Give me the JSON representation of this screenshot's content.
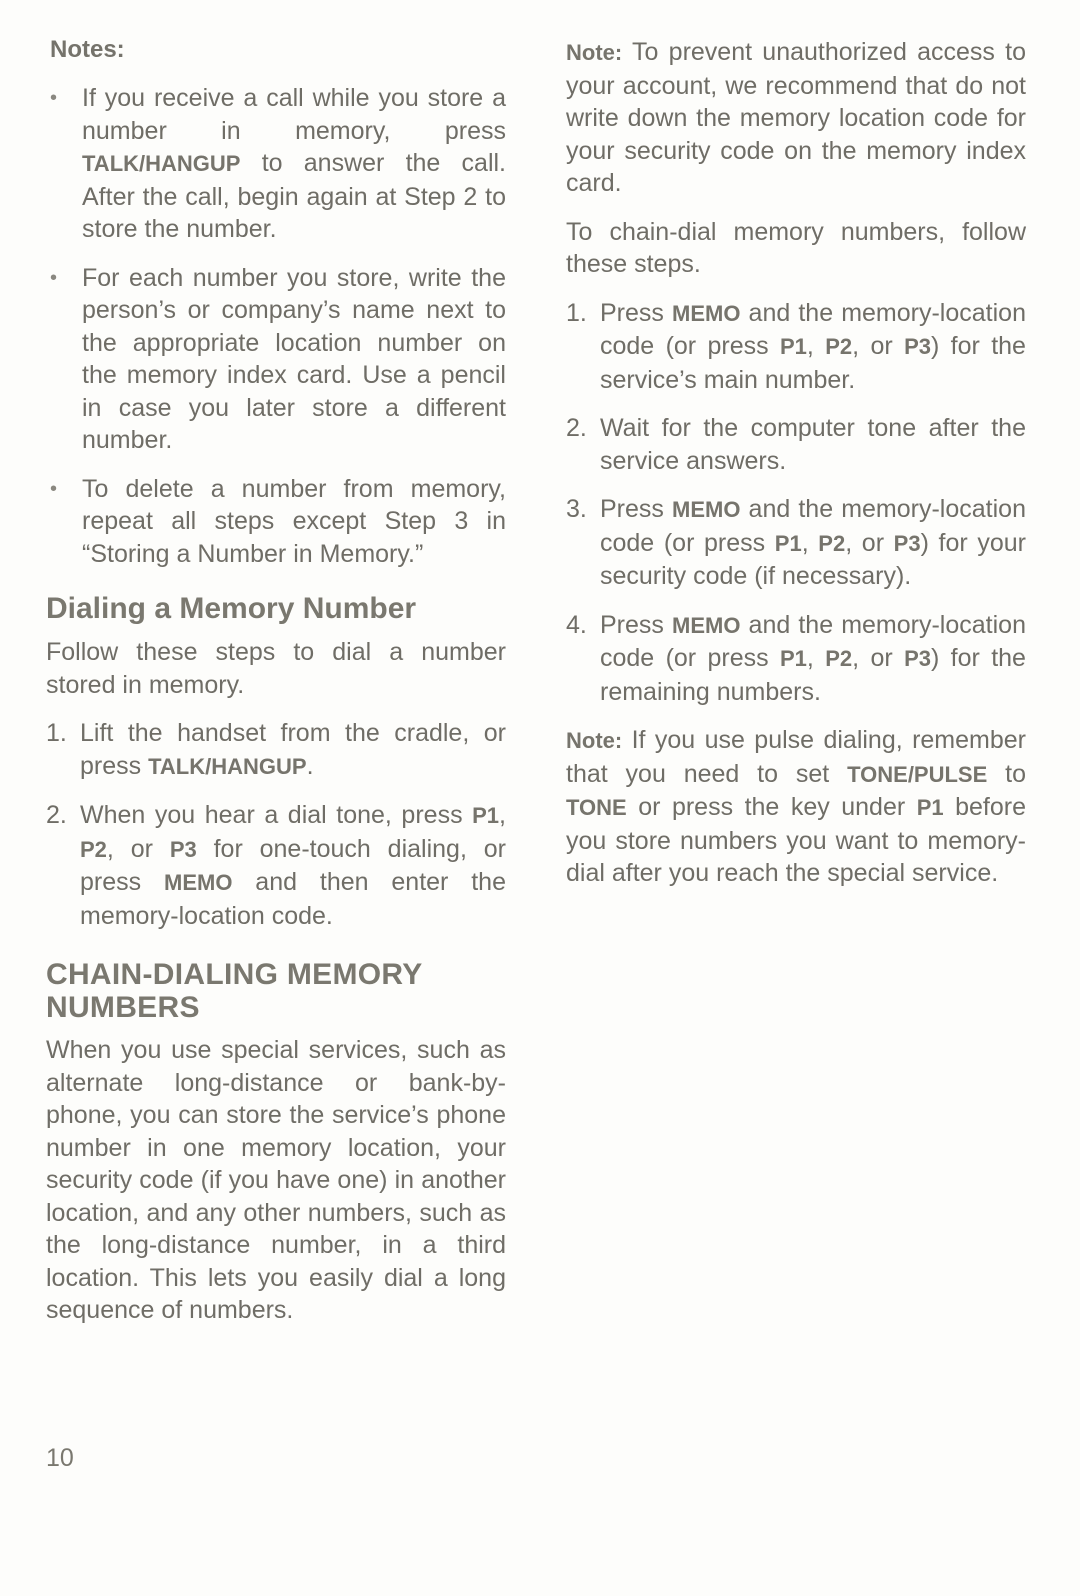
{
  "page_number": "10",
  "left": {
    "notes_title": "Notes:",
    "notes": [
      {
        "pre": "If you receive a call while you store a number in memory, press ",
        "key": "TALK/HANGUP",
        "post": " to answer the call. After the call, begin again at Step 2 to store the number."
      },
      {
        "pre": "For each number you store, write the person’s or company’s name next to the appropriate location number on the memory index card. Use a pencil in case you later store a different number.",
        "key": "",
        "post": ""
      },
      {
        "pre": "To delete a number from memory, repeat all steps except Step 3 in “Storing a Number in Memory.”",
        "key": "",
        "post": ""
      }
    ],
    "dialing_heading": "Dialing a Memory Number",
    "dialing_intro": "Follow these steps to dial a number stored in memory.",
    "dialing_steps": [
      {
        "num": "1.",
        "t1": "Lift the handset from the cradle, or press ",
        "k1": "TALK/HANGUP",
        "t2": "."
      },
      {
        "num": "2.",
        "t1": "When you hear a dial tone, press ",
        "k1": "P1",
        "t2": ", ",
        "k2": "P2",
        "t3": ", or ",
        "k3": "P3",
        "t4": " for one-touch dialing, or press ",
        "k4": "MEMO",
        "t5": " and then enter the memory-location code."
      }
    ],
    "chain_heading_line1": "CHAIN-DIALING MEMORY",
    "chain_heading_line2": "NUMBERS",
    "chain_body": "When you use special services, such as alternate long-distance or bank-by-phone, you can store the service’s phone number in one memory location, your security code (if you have one) in another location, and any other numbers, such as the long-distance number, in a third location. This lets you easily dial a long sequence of numbers."
  },
  "right": {
    "note1_label": "Note:",
    "note1_text": " To prevent unauthorized access to your account, we recommend that do not write down the memory location code for your security code on the memory index card.",
    "chain_intro": "To chain-dial memory numbers, follow these steps.",
    "steps": [
      {
        "num": "1.",
        "t1": "Press ",
        "k1": "MEMO",
        "t2": " and the memory-location code (or press ",
        "k2": "P1",
        "t3": ", ",
        "k3": "P2",
        "t4": ", or ",
        "k4": "P3",
        "t5": ") for the service’s main number."
      },
      {
        "num": "2.",
        "t1": "Wait for the computer tone after the service answers."
      },
      {
        "num": "3.",
        "t1": "Press ",
        "k1": "MEMO",
        "t2": " and the memory-location code (or press ",
        "k2": "P1",
        "t3": ", ",
        "k3": "P2",
        "t4": ", or ",
        "k4": "P3",
        "t5": ") for your security code (if necessary)."
      },
      {
        "num": "4.",
        "t1": "Press ",
        "k1": "MEMO",
        "t2": " and the memory-location code (or press ",
        "k2": "P1",
        "t3": ", ",
        "k3": "P2",
        "t4": ", or ",
        "k4": "P3",
        "t5": ") for the remaining numbers."
      }
    ],
    "note2_label": "Note:",
    "note2_t1": " If you use pulse dialing, remember that you need to set ",
    "note2_k1": "TONE/PULSE",
    "note2_t2": " to ",
    "note2_k2": "TONE",
    "note2_t3": " or press the key under ",
    "note2_k3": "P1",
    "note2_t4": " before you store numbers you want to memory-dial after you reach the special service."
  }
}
